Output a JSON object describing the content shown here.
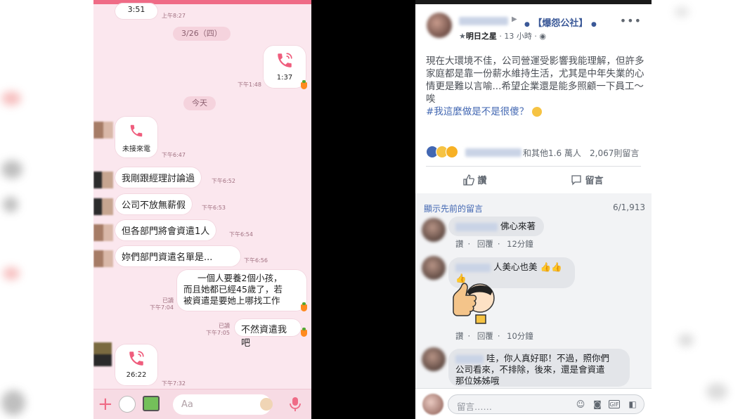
{
  "chat": {
    "call_top_duration": "3:51",
    "call_top_time": "上午8:27",
    "date_1": "3/26（四）",
    "call_mid_duration": "1:37",
    "call_mid_time": "下午1:48",
    "date_today": "今天",
    "missed_call_label": "未接來電",
    "missed_call_time": "下午6:47",
    "messages_in": [
      {
        "text": "我剛跟經理討論過",
        "time": "下午6:52"
      },
      {
        "text": "公司不放無薪假",
        "time": "下午6:53"
      },
      {
        "text": "但各部門將會資遣1人",
        "time": "下午6:54"
      },
      {
        "text": "妳們部門資遣名單是...",
        "time": "下午6:56"
      }
    ],
    "messages_out": [
      {
        "text_lines": [
          "一個人要養2個小孩，",
          "而且她都已經45歲了，若",
          "被資遣是要她上哪找工作"
        ],
        "read": "已讀",
        "time": "下午7:04"
      },
      {
        "text_lines": [
          "不然資遣我吧"
        ],
        "read": "已讀",
        "time": "下午7:05"
      }
    ],
    "call_bottom_duration": "26:22",
    "call_bottom_time": "下午7:32",
    "input_placeholder": "Aa",
    "accent_color": "#ef6b86"
  },
  "post": {
    "group_name": "【爆怨公社】",
    "badge": "明日之星",
    "time": "13 小時",
    "body": "現在大環境不佳，公司營運受影響我能理解，但許多家庭都是靠一份薪水維持生活，尤其是中年失業的心情更是難以言喻...希望企業還是能多照顧一下員工～唉",
    "hashtag": "#我這麼做是不是很傻？",
    "reactions_text": "和其他1.6 萬人",
    "comments_count": "2,067則留言",
    "like_label": "讚",
    "comment_label": "留言",
    "prev_comments": "顯示先前的留言",
    "comment_page": "6/1,913",
    "comments": [
      {
        "text": "佛心來著",
        "like": "讚",
        "reply": "回覆",
        "time": "12分鐘"
      },
      {
        "text": "人美心也美",
        "like": "讚",
        "reply": "回覆",
        "time": "10分鐘"
      },
      {
        "text_lines": [
          "哇，你人真好耶！不過，照你們",
          "公司看來，不排除，後來，還是會資遣",
          "那位姊姊哦"
        ]
      }
    ],
    "compose_placeholder": "留言……",
    "link_color": "#4267b2"
  }
}
